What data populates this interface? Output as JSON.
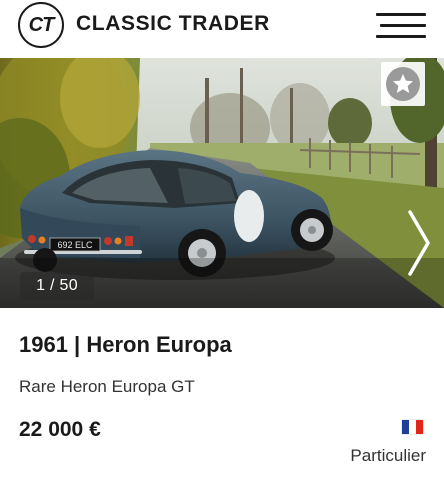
{
  "header": {
    "logo_text": "CT",
    "brand": "CLASSIC TRADER",
    "menu_icon": "hamburger-menu-icon"
  },
  "gallery": {
    "counter": "1 / 50",
    "favorite_icon": "star-icon",
    "next_icon": "chevron-right-icon",
    "plate_text": "692 ELC"
  },
  "listing": {
    "title": "1961 | Heron Europa",
    "subtitle": "Rare Heron Europa GT",
    "price": "22 000 €",
    "country_flag": {
      "icon": "france-flag-icon",
      "colors": [
        "#1f3f9a",
        "#ffffff",
        "#e1261c"
      ]
    },
    "seller_type": "Particulier"
  },
  "colors": {
    "text": "#1a1a1a",
    "car_body": "#3e5564"
  }
}
